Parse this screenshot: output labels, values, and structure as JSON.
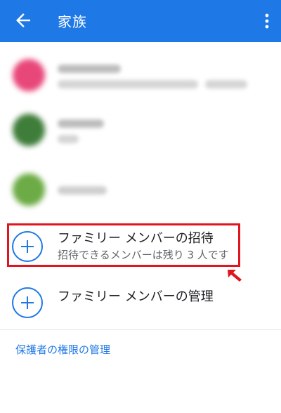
{
  "appbar": {
    "title": "家族",
    "back_icon": "arrow-left-icon",
    "menu_icon": "more-vert-icon",
    "color": "#1e78e6"
  },
  "members": [
    {
      "avatar_color": "#e8477a",
      "icon": "avatar"
    },
    {
      "avatar_color": "#3f7d3a",
      "icon": "avatar"
    },
    {
      "avatar_color": "#6cab45",
      "icon": "avatar"
    }
  ],
  "invite": {
    "title": "ファミリー メンバーの招待",
    "subtitle": "招待できるメンバーは残り 3 人です",
    "icon": "add-circle-icon"
  },
  "manage": {
    "title": "ファミリー メンバーの管理",
    "icon": "add-circle-icon"
  },
  "parental_link": "保護者の権限の管理",
  "annotation": {
    "highlight_color": "#e0161e",
    "pointer_icon": "red-arrow-pointer-icon"
  }
}
